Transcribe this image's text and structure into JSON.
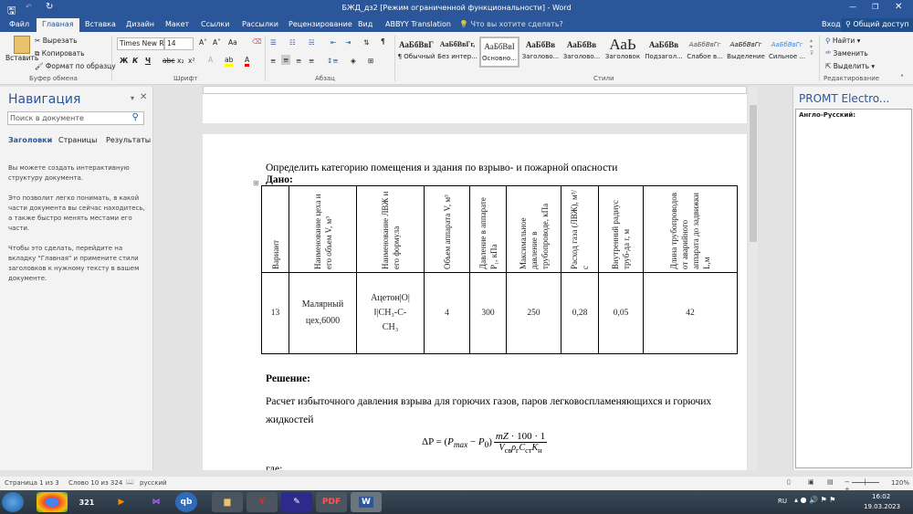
{
  "window": {
    "title": "БЖД_дз2 [Режим ограниченной функциональности] - Word"
  },
  "tabs": [
    "Файл",
    "Главная",
    "Вставка",
    "Дизайн",
    "Макет",
    "Ссылки",
    "Рассылки",
    "Рецензирование",
    "Вид",
    "ABBYY Translation"
  ],
  "tell_me": "Что вы хотите сделать?",
  "signin": "Вход",
  "share": "Общий доступ",
  "clipboard": {
    "paste": "Вставить",
    "cut": "Вырезать",
    "copy": "Копировать",
    "format": "Формат по образцу",
    "group": "Буфер обмена"
  },
  "font": {
    "name": "Times New R",
    "size": "14",
    "group": "Шрифт",
    "bold": "Ж",
    "italic": "К",
    "underline": "Ч",
    "strike": "abc",
    "sub": "x₂",
    "sup": "x²",
    "case": "Aa"
  },
  "paragraph": {
    "group": "Абзац"
  },
  "styles": {
    "group": "Стили",
    "items": [
      {
        "sample": "АаБбВвГ",
        "name": "¶ Обычный"
      },
      {
        "sample": "АаБбВвГг,",
        "name": "Без интер..."
      },
      {
        "sample": "АаБбВвІ",
        "name": "Основно..."
      },
      {
        "sample": "АаБбВв",
        "name": "Заголово..."
      },
      {
        "sample": "АаБбВв",
        "name": "Заголово..."
      },
      {
        "sample": "АаЬ",
        "name": "Заголовок"
      },
      {
        "sample": "АаБбВв",
        "name": "Подзагол..."
      },
      {
        "sample": "АаБбВвГг",
        "name": "Слабое в..."
      },
      {
        "sample": "АаБбВвГг",
        "name": "Выделение"
      },
      {
        "sample": "АаБбВвГг",
        "name": "Сильное ..."
      }
    ]
  },
  "editing": {
    "find": "Найти",
    "replace": "Заменить",
    "select": "Выделить",
    "group": "Редактирование"
  },
  "nav": {
    "title": "Навигация",
    "search_placeholder": "Поиск в документе",
    "tabs": [
      "Заголовки",
      "Страницы",
      "Результаты"
    ],
    "p1": "Вы можете создать интерактивную структуру документа.",
    "p2": "Это позволит легко понимать, в какой части документа вы сейчас находитесь, а также быстро менять местами его части.",
    "p3": "Чтобы это сделать, перейдите на вкладку \"Главная\" и примените стили заголовков к нужному тексту в вашем документе."
  },
  "doc": {
    "task": "Определить категорию помещения и здания по взрыво- и пожарной опасности",
    "given": "Дано:",
    "headers": [
      "Вариант",
      "Наименование цеха и его объем V, м³",
      "Наименование ЛВЖ и его формула",
      "Объем аппарата V, м³",
      "Давление в аппарате P₁, кПа",
      "Максимальное давление в трубопроводе, кПа",
      "Расход газа (ЛВЖ), м³/с",
      "Внутренний радиус труб-да r, м",
      "Длина трубопроводов от аварийного аппарата до задвижки L,м"
    ],
    "row": [
      "13",
      "Малярный цех,6000",
      "Ацетон|O|‖|CH₃-C- CH₃",
      "4",
      "300",
      "250",
      "0,28",
      "0,05",
      "42"
    ],
    "solution": "Решение:",
    "calc": "Расчет избыточного давления взрыва для горючих газов, паров легковоспламеняющихся и горючих жидкостей",
    "where": "где:"
  },
  "promt": {
    "title": "PROMT Electro...",
    "dir": "Англо-Русский:"
  },
  "status": {
    "page": "Страница 1 из 3",
    "words": "Слово 10 из 324",
    "lang": "русский",
    "zoom": "120%"
  },
  "tray": {
    "lang": "RU",
    "time": "16:02",
    "date": "19.03.2023"
  }
}
